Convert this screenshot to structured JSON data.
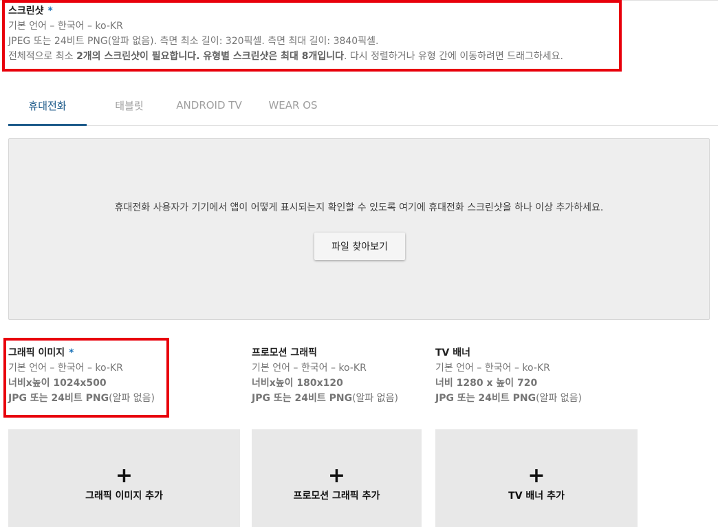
{
  "screenshots": {
    "title": "스크린샷",
    "required_mark": "*",
    "language_line": "기본 언어 – 한국어 – ko-KR",
    "format_line": "JPEG 또는 24비트 PNG(알파 없음). 측면 최소 길이: 320픽셀. 측면 최대 길이: 3840픽셀.",
    "rule_prefix": "전체적으로 최소 ",
    "rule_bold_1": "2개의 스크린샷이 필요합니다. 유형별 스크린샷은 최대 8개입니다",
    "rule_suffix": ". 다시 정렬하거나 유형 간에 이동하려면 드래그하세요."
  },
  "tabs": [
    {
      "label": "휴대전화",
      "active": true
    },
    {
      "label": "태블릿",
      "active": false
    },
    {
      "label": "ANDROID TV",
      "active": false
    },
    {
      "label": "WEAR OS",
      "active": false
    }
  ],
  "dropzone": {
    "message": "휴대전화 사용자가 기기에서 앱이 어떻게 표시되는지 확인할 수 있도록 여기에 휴대전화 스크린샷을 하나 이상 추가하세요.",
    "browse_label": "파일 찾아보기"
  },
  "graphics": [
    {
      "title": "그래픽 이미지",
      "required_mark": "*",
      "language": "기본 언어 – 한국어 – ko-KR",
      "size": "너비x높이 1024x500",
      "format_prefix": "JPG 또는 ",
      "format_bold": "24비트 PNG",
      "format_suffix": "(알파 없음)",
      "add_icon": "plus-icon",
      "add_label": "그래픽 이미지 추가"
    },
    {
      "title": "프로모션 그래픽",
      "language": "기본 언어 – 한국어 – ko-KR",
      "size": "너비x높이 180x120",
      "format_prefix": "JPG 또는 ",
      "format_bold": "24비트 PNG",
      "format_suffix": "(알파 없음)",
      "add_icon": "plus-icon",
      "add_label": "프로모션 그래픽 추가"
    },
    {
      "title": "TV 배너",
      "language": "기본 언어 – 한국어 – ko-KR",
      "size": "너비 1280 x 높이 720",
      "format_prefix": "JPG 또는 ",
      "format_bold": "24비트 PNG",
      "format_suffix": "(알파 없음)",
      "add_icon": "plus-icon",
      "add_label": "TV 배너 추가"
    }
  ],
  "colors": {
    "highlight": "#e8000b",
    "tab_active": "#1c5a8a",
    "required_star": "#1a73b8",
    "dropzone_bg": "#eeeeee",
    "tile_bg": "#e8e8e8"
  }
}
